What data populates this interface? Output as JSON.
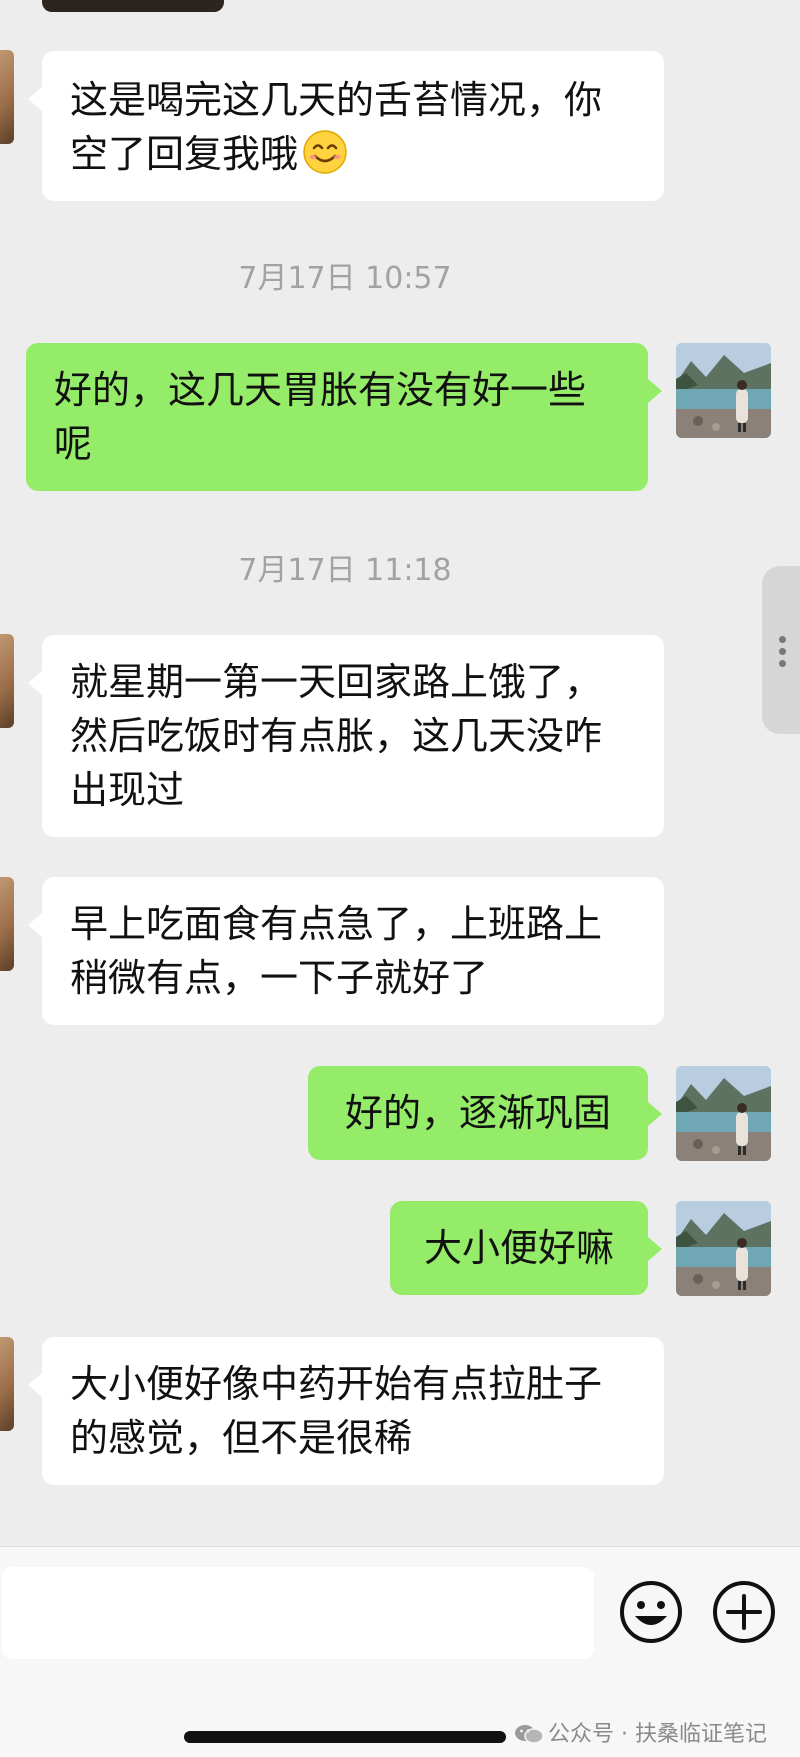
{
  "messages": [
    {
      "side": "in",
      "text": "这是喝完这几天的舌苔情况，你空了回复我哦",
      "emoji": "smiling-face"
    },
    {
      "timestamp": "7月17日 10:57"
    },
    {
      "side": "out",
      "text": "好的，这几天胃胀有没有好一些呢"
    },
    {
      "timestamp": "7月17日 11:18"
    },
    {
      "side": "in",
      "text": "就星期一第一天回家路上饿了，然后吃饭时有点胀，这几天没咋出现过"
    },
    {
      "side": "in",
      "text": "早上吃面食有点急了，上班路上稍微有点，一下子就好了"
    },
    {
      "side": "out",
      "text": "好的，逐渐巩固"
    },
    {
      "side": "out",
      "text": "大小便好嘛"
    },
    {
      "side": "in",
      "text": "大小便好像中药开始有点拉肚子的感觉，但不是很稀"
    }
  ],
  "input": {
    "placeholder": ""
  },
  "toolbar": {
    "emoji_icon": "emoji-icon",
    "plus_icon": "plus-icon"
  },
  "watermark": {
    "text": "公众号 · 扶桑临证笔记"
  },
  "colors": {
    "background": "#ededed",
    "incoming_bubble": "#ffffff",
    "outgoing_bubble": "#95ec69",
    "timestamp": "#a2a2a2"
  }
}
